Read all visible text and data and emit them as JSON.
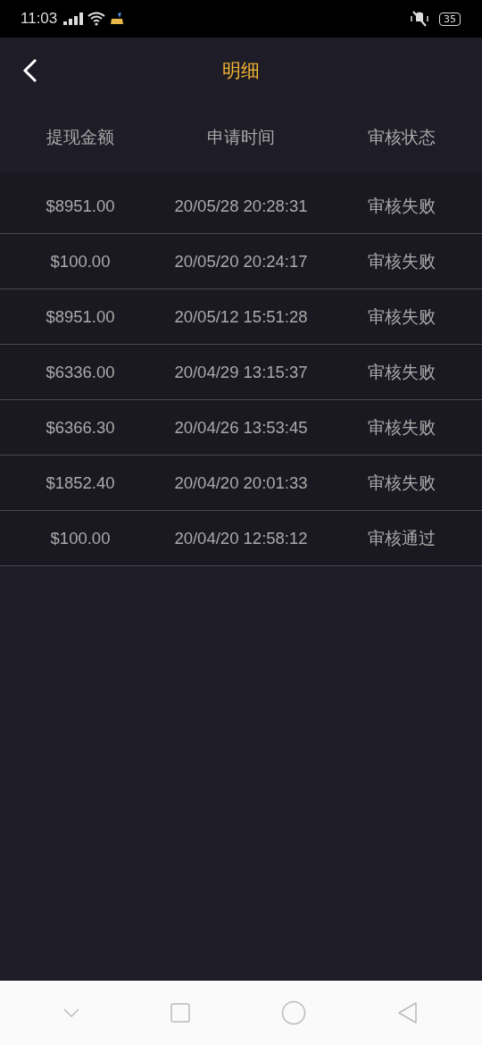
{
  "status_bar": {
    "time": "11:03",
    "battery": "35"
  },
  "header": {
    "title": "明细"
  },
  "table": {
    "columns": [
      "提现金额",
      "申请时间",
      "审核状态"
    ],
    "rows": [
      {
        "amount": "$8951.00",
        "time": "20/05/28 20:28:31",
        "status": "审核失败"
      },
      {
        "amount": "$100.00",
        "time": "20/05/20 20:24:17",
        "status": "审核失败"
      },
      {
        "amount": "$8951.00",
        "time": "20/05/12 15:51:28",
        "status": "审核失败"
      },
      {
        "amount": "$6336.00",
        "time": "20/04/29 13:15:37",
        "status": "审核失败"
      },
      {
        "amount": "$6366.30",
        "time": "20/04/26 13:53:45",
        "status": "审核失败"
      },
      {
        "amount": "$1852.40",
        "time": "20/04/20 20:01:33",
        "status": "审核失败"
      },
      {
        "amount": "$100.00",
        "time": "20/04/20 12:58:12",
        "status": "审核通过"
      }
    ]
  }
}
